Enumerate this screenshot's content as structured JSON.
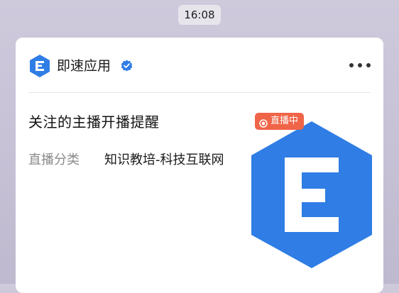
{
  "status_bar": {
    "time": "16:08"
  },
  "card": {
    "app_name": "即速应用",
    "app_logo_icon": "jisu-app-logo-icon",
    "verified_icon": "verified-badge-icon",
    "more_icon": "more-dots-icon",
    "title": "关注的主播开播提醒",
    "field_label": "直播分类",
    "field_value": "知识教培-科技互联网",
    "live_badge": "直播中",
    "colors": {
      "brand_blue": "#2f7de5",
      "live_red": "#f06448",
      "label_gray": "#8a8a8a"
    }
  }
}
